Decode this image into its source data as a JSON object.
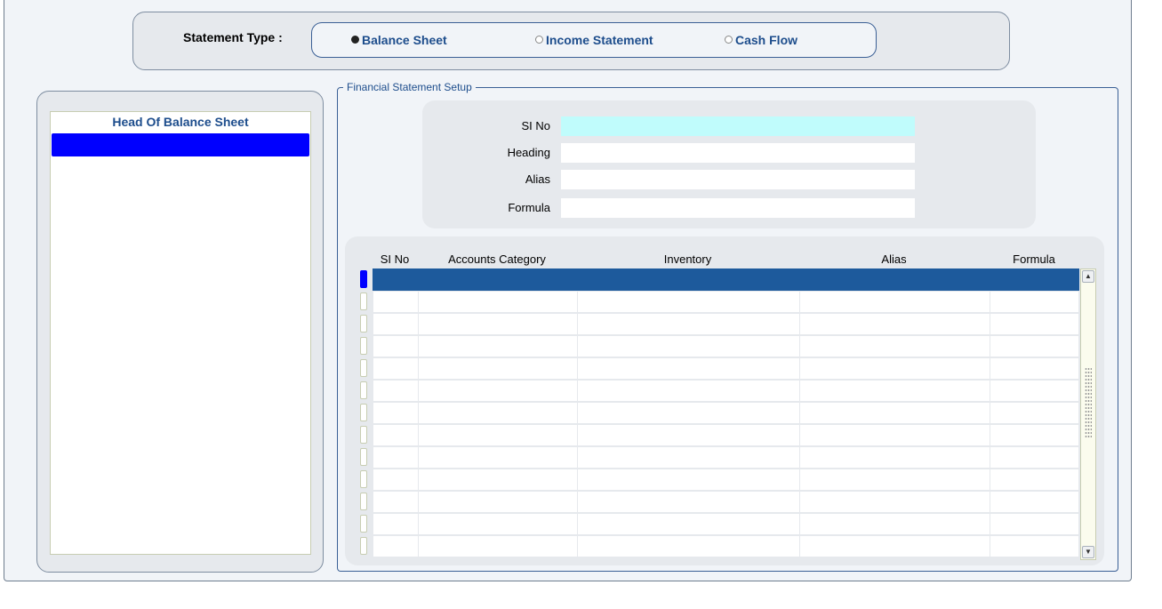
{
  "statement_type": {
    "label": "Statement Type :",
    "options": [
      {
        "label": "Balance Sheet",
        "selected": true
      },
      {
        "label": "Income Statement",
        "selected": false
      },
      {
        "label": "Cash Flow",
        "selected": false
      }
    ]
  },
  "left_list": {
    "title": "Head Of Balance Sheet",
    "selected_color": "#0000ff"
  },
  "setup": {
    "legend": "Financial Statement Setup",
    "fields": [
      {
        "label": "SI No",
        "value": ""
      },
      {
        "label": "Heading",
        "value": ""
      },
      {
        "label": "Alias",
        "value": ""
      },
      {
        "label": "Formula",
        "value": ""
      }
    ]
  },
  "grid": {
    "columns": [
      "SI No",
      "Accounts Category",
      "Inventory",
      "Alias",
      "Formula"
    ],
    "row_count": 13,
    "selected_row_color": "#1d5a9c",
    "scroll_up_icon": "arrow-up-icon",
    "scroll_down_icon": "arrow-down-icon"
  }
}
